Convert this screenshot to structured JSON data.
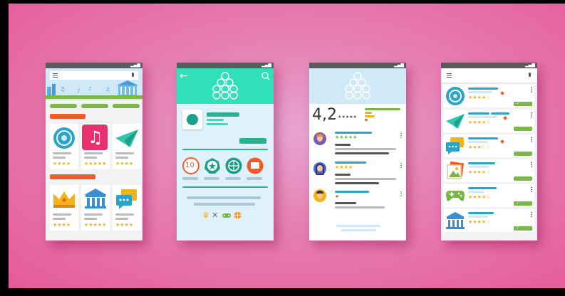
{
  "colors": {
    "background": "#e675b0",
    "frame": "#000000",
    "teal": "#2fe0b8",
    "light_blue": "#cfeaf6",
    "orange": "#ef5a2a",
    "green": "#7ab648",
    "star": "#f2b318"
  },
  "phone_store": {
    "menu_icon": "hamburger-icon",
    "mic_icon": "microphone-icon",
    "apps": [
      {
        "icon": "camera-shutter-icon",
        "stars": "★★★★"
      },
      {
        "icon": "music-note-icon",
        "stars": "★★★★★"
      },
      {
        "icon": "paper-plane-icon",
        "stars": "★★★★"
      },
      {
        "icon": "crown-icon",
        "stars": "★★★★"
      },
      {
        "icon": "museum-icon",
        "stars": "★★★★★"
      },
      {
        "icon": "chat-bubbles-icon",
        "stars": "★★★★"
      }
    ]
  },
  "phone_detail": {
    "back_icon": "arrow-back-icon",
    "search_icon": "search-icon",
    "badge_number": "10",
    "bottom_icons": [
      "crown-icon",
      "crossed-swords-icon",
      "gamepad-icon",
      "basketball-icon"
    ]
  },
  "phone_reviews": {
    "rating": "4,2",
    "rating_stars": "★★★★★",
    "reviews": [
      {
        "stars": "★★★★★"
      },
      {
        "stars": "★★★★"
      },
      {
        "stars": "★"
      }
    ]
  },
  "phone_list": {
    "menu_icon": "hamburger-icon",
    "mic_icon": "microphone-icon",
    "items": [
      {
        "icon": "camera-shutter-icon",
        "stars": "★★★★☆",
        "check": "✓"
      },
      {
        "icon": "paper-plane-icon",
        "stars": "★★★★☆",
        "check": ""
      },
      {
        "icon": "chat-bubbles-icon",
        "stars": "★★★☆☆",
        "check": ""
      },
      {
        "icon": "picture-icon",
        "stars": "★★★★☆",
        "check": ""
      },
      {
        "icon": "gamepad-icon",
        "stars": "★★★★☆",
        "check": "✓"
      },
      {
        "icon": "museum-icon",
        "stars": "★★★★☆",
        "check": "✓"
      }
    ]
  }
}
